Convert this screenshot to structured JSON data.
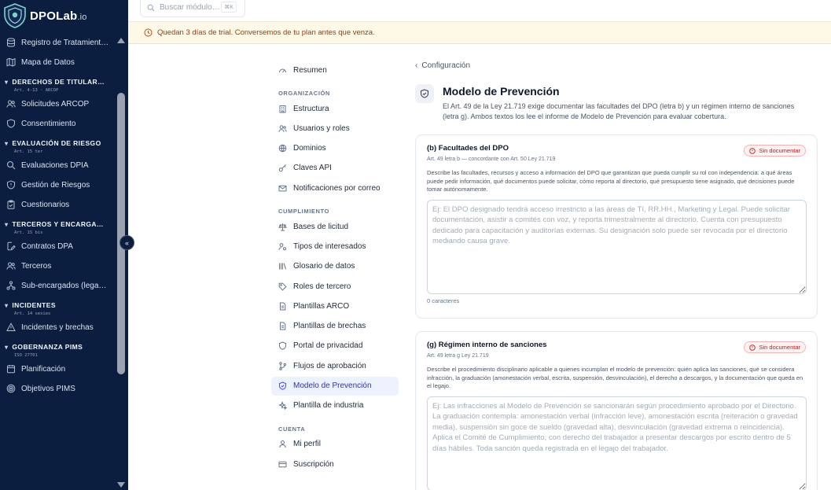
{
  "app": {
    "brand": "DPOLab",
    "brand_suffix": ".io"
  },
  "search": {
    "placeholder": "Buscar módulo…",
    "shortcut": "⌘K"
  },
  "trial_banner": "Quedan 3 días de trial. Conversemos de tu plan antes que venza.",
  "sidebar": {
    "top_items": [
      {
        "label": "Registro de Tratamient…",
        "icon": "database-icon"
      },
      {
        "label": "Mapa de Datos",
        "icon": "map-icon"
      }
    ],
    "sections": [
      {
        "title": "DERECHOS DE TITULAR…",
        "sub": "Art. 4-13 · ARCOP",
        "items": [
          {
            "label": "Solicitudes ARCOP",
            "icon": "users-icon"
          },
          {
            "label": "Consentimiento",
            "icon": "shield-icon"
          }
        ]
      },
      {
        "title": "EVALUACIÓN DE RIESGO",
        "sub": "Art. 15 ter",
        "items": [
          {
            "label": "Evaluaciones DPIA",
            "icon": "search-icon"
          },
          {
            "label": "Gestión de Riesgos",
            "icon": "shield-icon"
          },
          {
            "label": "Cuestionarios",
            "icon": "clipboard-icon"
          }
        ]
      },
      {
        "title": "TERCEROS Y ENCARGA…",
        "sub": "Art. 15 bis",
        "items": [
          {
            "label": "Contratos DPA",
            "icon": "file-edit-icon"
          },
          {
            "label": "Terceros",
            "icon": "users-icon"
          },
          {
            "label": "Sub-encargados (lega…",
            "icon": "network-icon"
          }
        ]
      },
      {
        "title": "INCIDENTES",
        "sub": "Art. 14 sexies",
        "items": [
          {
            "label": "Incidentes y brechas",
            "icon": "alert-icon"
          }
        ]
      },
      {
        "title": "GOBERNANZA PIMS",
        "sub": "ISO 27701",
        "items": [
          {
            "label": "Planificación",
            "icon": "calendar-icon"
          },
          {
            "label": "Objetivos PIMS",
            "icon": "target-icon"
          }
        ]
      }
    ]
  },
  "settings_nav": {
    "summary": "Resumen",
    "org_head": "ORGANIZACIÓN",
    "org": [
      "Estructura",
      "Usuarios y roles",
      "Dominios",
      "Claves API",
      "Notificaciones por correo"
    ],
    "comp_head": "CUMPLIMIENTO",
    "comp": [
      "Bases de licitud",
      "Tipos de interesados",
      "Glosario de datos",
      "Roles de tercero",
      "Plantillas ARCO",
      "Plantillas de brechas",
      "Portal de privacidad",
      "Flujos de aprobación",
      "Modelo de Prevención",
      "Plantilla de industria"
    ],
    "acct_head": "CUENTA",
    "acct": [
      "Mi perfil",
      "Suscripción"
    ]
  },
  "main": {
    "back": "Configuración",
    "title": "Modelo de Prevención",
    "description": "El Art. 49 de la Ley 21.719 exige documentar las facultades del DPO (letra b) y un régimen interno de sanciones (letra g). Ambos textos los lee el informe de Modelo de Prevención para evaluar cobertura.",
    "card_b": {
      "title": "(b) Facultades del DPO",
      "ref": "Art. 49 letra b — concordante con Art. 50 Ley 21.719",
      "status": "Sin documentar",
      "desc": "Describe las facultades, recursos y acceso a información del DPO que garantizan que pueda cumplir su rol con independencia: a qué áreas puede pedir información, qué documentos puede solicitar, cómo reporta al directorio, qué presupuesto tiene asignado, qué decisiones puede tomar autónomamente.",
      "placeholder": "Ej: El DPO designado tendrá acceso irrestricto a las áreas de TI, RR.HH., Marketing y Legal. Puede solicitar documentación, asistir a comités con voz, y reporta trimestralmente al directorio. Cuenta con presupuesto dedicado para capacitación y auditorías externas. Su designación solo puede ser revocada por el directorio mediando causa grave.",
      "count": "0 caracteres"
    },
    "card_g": {
      "title": "(g) Régimen interno de sanciones",
      "ref": "Art. 49 letra g Ley 21.719",
      "status": "Sin documentar",
      "desc": "Describe el procedimiento disciplinario aplicable a quienes incumplan el modelo de prevención: quién aplica las sanciones, qué se considera infracción, la graduación (amonestación verbal, escrita, suspensión, desvinculación), el derecho a descargos, y la documentación que queda en el legajo.",
      "placeholder": "Ej: Las infracciones al Modelo de Prevención se sancionarán según procedimiento aprobado por el Directorio. La graduación contempla: amonestación verbal (infracción leve), amonestación escrita (reiteración o gravedad media), suspensión sin goce de sueldo (gravedad alta), desvinculación (gravedad extrema o reincidencia). Aplica el Comité de Cumplimiento, con derecho del trabajador a presentar descargos por escrito dentro de 5 días hábiles. Toda sanción queda registrada en el legajo del trabajador."
    }
  },
  "colors": {
    "sidebar_bg": "#0b1e3f",
    "accent": "#4f46e5",
    "danger": "#b91c1c",
    "banner_bg": "#fef8e7"
  }
}
